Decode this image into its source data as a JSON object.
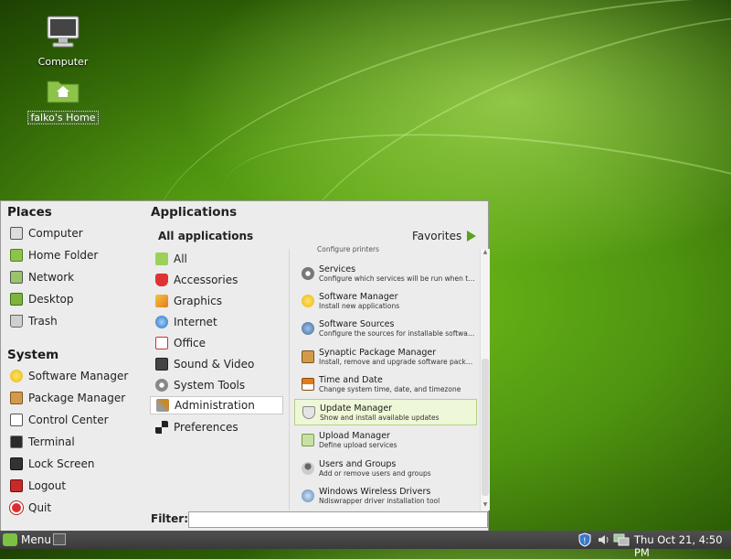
{
  "desktop": {
    "icons": [
      {
        "label": "Computer"
      },
      {
        "label": "falko's Home"
      }
    ]
  },
  "menu": {
    "places": {
      "heading": "Places",
      "items": [
        "Computer",
        "Home Folder",
        "Network",
        "Desktop",
        "Trash"
      ]
    },
    "system": {
      "heading": "System",
      "items": [
        "Software Manager",
        "Package Manager",
        "Control Center",
        "Terminal",
        "Lock Screen",
        "Logout",
        "Quit"
      ]
    },
    "applications": {
      "heading": "Applications",
      "all_label": "All applications",
      "favorites_label": "Favorites",
      "categories": [
        "All",
        "Accessories",
        "Graphics",
        "Internet",
        "Office",
        "Sound & Video",
        "System Tools",
        "Administration",
        "Preferences"
      ],
      "selected_category": "Administration",
      "clipped_top_text": "Configure printers",
      "apps": [
        {
          "name": "Services",
          "desc": "Configure which services will be run when the sys..."
        },
        {
          "name": "Software Manager",
          "desc": "Install new applications"
        },
        {
          "name": "Software Sources",
          "desc": "Configure the sources for installable software and ..."
        },
        {
          "name": "Synaptic Package Manager",
          "desc": "Install, remove and upgrade software packages"
        },
        {
          "name": "Time and Date",
          "desc": "Change system time, date, and timezone"
        },
        {
          "name": "Update Manager",
          "desc": "Show and install available updates"
        },
        {
          "name": "Upload Manager",
          "desc": "Define upload services"
        },
        {
          "name": "Users and Groups",
          "desc": "Add or remove users and groups"
        },
        {
          "name": "Windows Wireless Drivers",
          "desc": "Ndiswrapper driver installation tool"
        }
      ],
      "selected_app": "Update Manager"
    },
    "filter": {
      "label": "Filter:",
      "value": ""
    }
  },
  "panel": {
    "menu_label": "Menu",
    "clock": "Thu Oct 21,  4:50 PM"
  }
}
